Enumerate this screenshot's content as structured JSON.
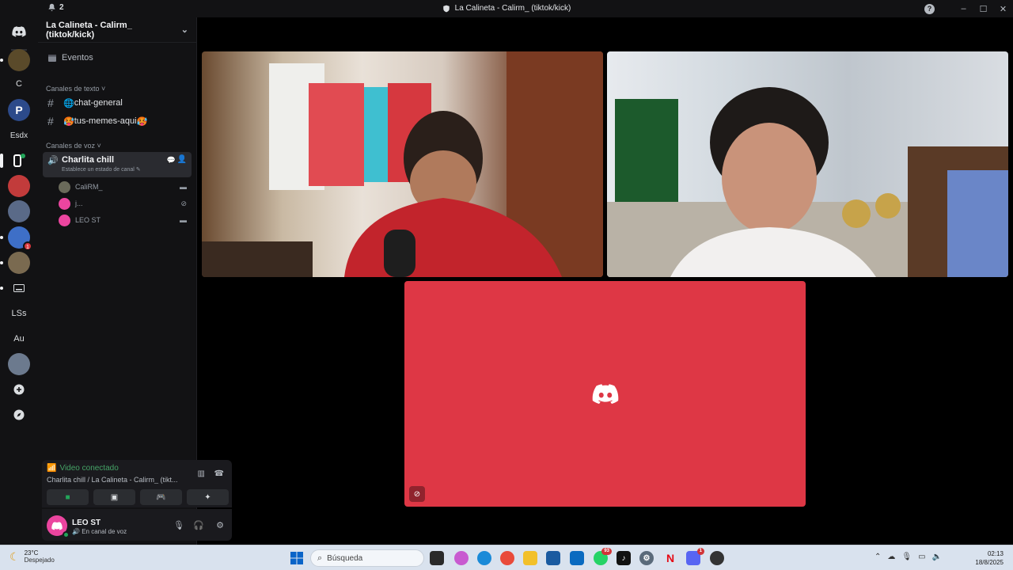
{
  "titlebar": {
    "notif_count": "2",
    "title": "La Calineta - Calirm_ (tiktok/kick)"
  },
  "rail": {
    "letter_c": "C",
    "esdx": "Esdx",
    "lss": "LSs",
    "au": "Au",
    "badge": "1"
  },
  "guild": {
    "name": "La Calineta - Calirm_ (tiktok/kick)",
    "events": "Eventos",
    "text_category": "Canales de texto",
    "voice_category": "Canales de voz",
    "channels": [
      {
        "name": "chat-general",
        "emoji": "🌐"
      },
      {
        "name": "tus-memes-aqui",
        "emoji": "🥵"
      }
    ],
    "voice_channel": {
      "name": "Charlita chill",
      "status_hint": "Establece un estado de canal"
    },
    "voice_users": [
      {
        "name": "CaliRM_"
      },
      {
        "name": "j..."
      },
      {
        "name": "LEO ST"
      }
    ]
  },
  "voice_panel": {
    "status": "Video conectado",
    "location": "Charlita chill / La Calineta - Calirm_ (tikt..."
  },
  "user_panel": {
    "name": "LEO ST",
    "status": "En canal de voz"
  },
  "taskbar": {
    "temp": "23°C",
    "weather": "Despejado",
    "search_placeholder": "Búsqueda",
    "time": "02:13",
    "date": "18/8/2025",
    "whatsapp_badge": "93",
    "discord_badge": "1"
  },
  "colors": {
    "avatar_tile": "#de3745",
    "connected": "#45a366",
    "sidebar": "#121214"
  }
}
